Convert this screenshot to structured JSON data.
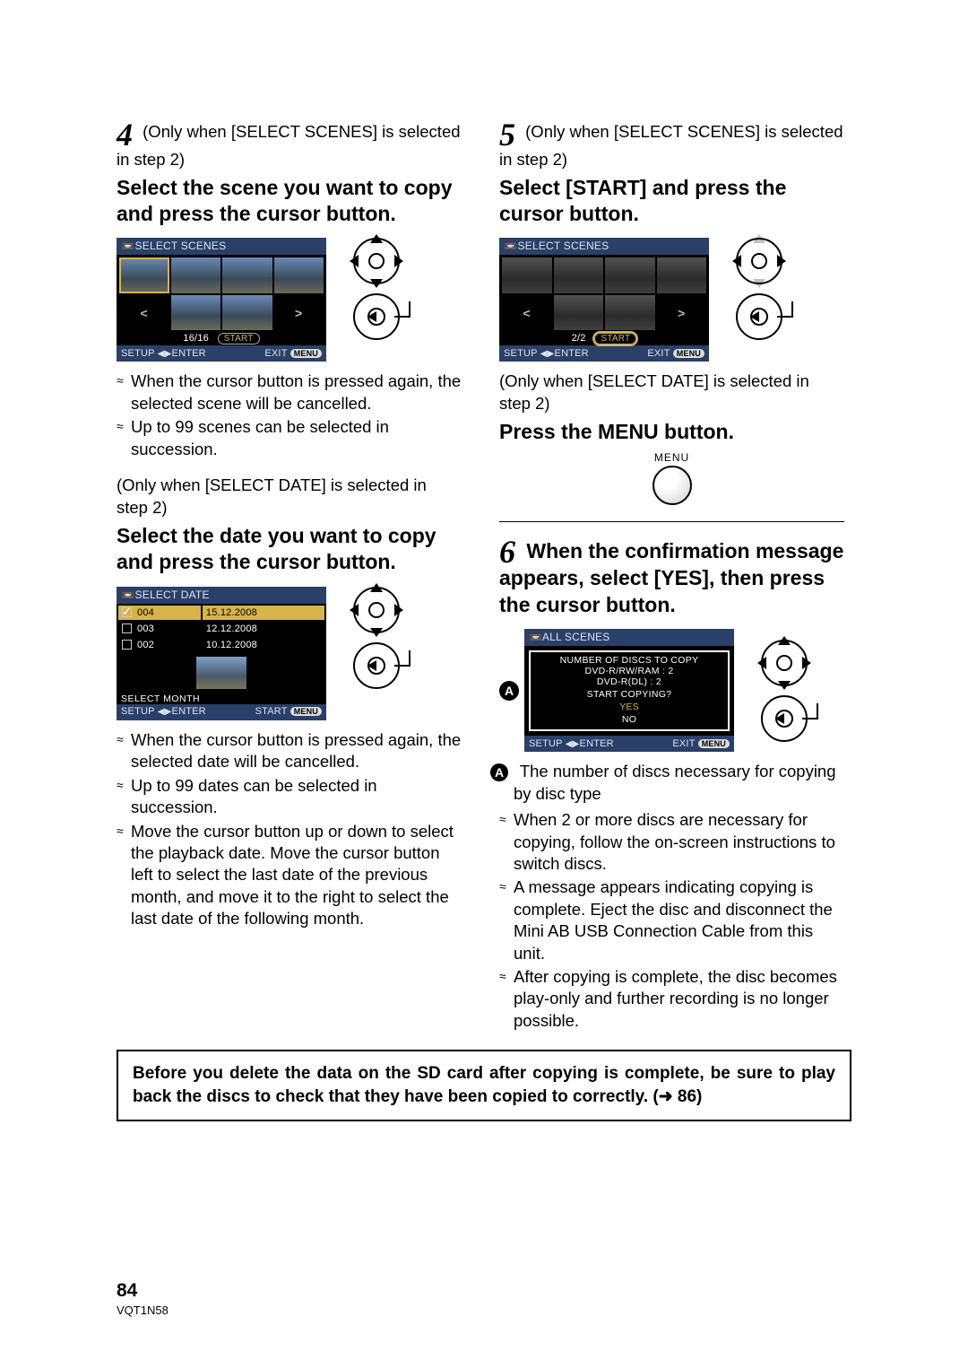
{
  "step4": {
    "pre": "(Only when [SELECT SCENES] is selected in step 2)",
    "title": "Select the scene you want to copy and press the cursor button.",
    "screen": {
      "header": "SELECT SCENES",
      "count": "16/16",
      "start": "START",
      "footer_left": "SETUP",
      "footer_mid": "ENTER",
      "footer_exit": "EXIT",
      "footer_menu": "MENU"
    },
    "bullets": [
      "When the cursor button is pressed again, the selected scene will be cancelled.",
      "Up to 99 scenes can be selected in succession."
    ]
  },
  "step4b": {
    "pre": "(Only when [SELECT DATE] is selected in step 2)",
    "title": "Select the date you want to copy and press the cursor button.",
    "screen": {
      "header": "SELECT DATE",
      "rows": [
        {
          "num": "004",
          "date": "15.12.2008",
          "checked": true,
          "sel": true
        },
        {
          "num": "003",
          "date": "12.12.2008",
          "checked": false,
          "sel": false
        },
        {
          "num": "002",
          "date": "10.12.2008",
          "checked": false,
          "sel": false
        }
      ],
      "select_month": "SELECT MONTH",
      "footer_left": "SETUP",
      "footer_mid": "ENTER",
      "start": "START",
      "footer_menu": "MENU"
    },
    "bullets": [
      "When the cursor button is pressed again, the selected date will be cancelled.",
      "Up to 99 dates can be selected in succession.",
      "Move the cursor button up or down to select the playback date. Move the cursor button left to select the last date of the previous month, and move it to the right to select the last date of the following month."
    ]
  },
  "step5": {
    "pre": "(Only when [SELECT SCENES] is selected in step 2)",
    "title": "Select [START] and press the cursor button.",
    "screen": {
      "header": "SELECT SCENES",
      "count": "2/2",
      "start": "START",
      "footer_left": "SETUP",
      "footer_mid": "ENTER",
      "footer_exit": "EXIT",
      "footer_menu": "MENU"
    }
  },
  "step5b": {
    "pre": "(Only when [SELECT DATE] is selected in step 2)",
    "title": "Press the MENU button.",
    "menu_label": "MENU"
  },
  "step6": {
    "title": "When the confirmation message appears, select [YES], then press the cursor button.",
    "screen": {
      "header": "ALL SCENES",
      "line1": "NUMBER OF DISCS TO COPY",
      "line2": "DVD-R/RW/RAM : 2",
      "line3": "DVD-R(DL) : 2",
      "line4": "START COPYING?",
      "yes": "YES",
      "no": "NO",
      "footer_left": "SETUP",
      "footer_mid": "ENTER",
      "footer_exit": "EXIT",
      "footer_menu": "MENU"
    },
    "callout_a_text": "The number of discs necessary for copying by disc type",
    "bullets": [
      "When 2 or more discs are necessary for copying, follow the on-screen instructions to switch discs.",
      "A message appears indicating copying is complete. Eject the disc and disconnect the Mini AB USB Connection Cable from this unit.",
      "After copying is complete, the disc becomes play-only and further recording is no longer possible."
    ]
  },
  "boxed": "Before you delete the data on the SD card after copying is complete, be sure to play back the discs to check that they have been copied to correctly. (➜ 86)",
  "page_number": "84",
  "doc_id": "VQT1N58"
}
